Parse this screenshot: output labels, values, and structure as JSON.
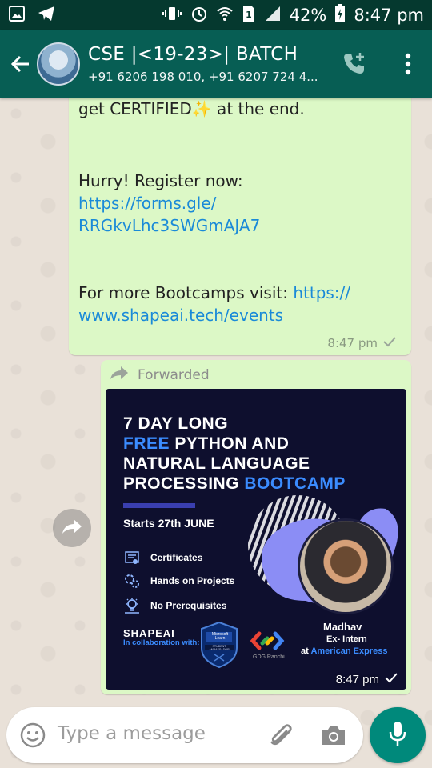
{
  "status_bar": {
    "battery_percent": "42%",
    "time": "8:47 pm",
    "icons": [
      "gallery-icon",
      "telegram-icon",
      "vibrate-icon",
      "alarm-icon",
      "wifi-icon",
      "sim-1-icon",
      "signal-icon",
      "battery-charging-icon"
    ]
  },
  "header": {
    "title": "CSE |<19-23>| BATCH",
    "subtitle": "+91 6206 198 010, +91 6207 724 4...",
    "icons": [
      "back-arrow-icon",
      "add-call-icon",
      "more-vert-icon"
    ]
  },
  "messages": [
    {
      "lines": [
        {
          "text": "get CERTIFIED✨ at the end.",
          "link": false
        },
        {
          "text": "Hurry! Register now:",
          "link": false
        },
        {
          "text": "https://forms.gle/",
          "link": true
        },
        {
          "text": "RRGkvLhc3SWGmAJA7",
          "link": true
        },
        {
          "text": "For more Bootcamps visit: ",
          "link": false
        },
        {
          "text": "https://",
          "link": true
        },
        {
          "text": "www.shapeai.tech/events",
          "link": true
        }
      ],
      "time": "8:47 pm"
    },
    {
      "forwarded_label": "Forwarded",
      "time": "8:47 pm",
      "poster": {
        "headline": [
          {
            "plain": "7 DAY LONG",
            "accent": ""
          },
          {
            "accent": "FREE",
            "plain": " PYTHON AND"
          },
          {
            "plain": "NATURAL LANGUAGE",
            "accent": ""
          },
          {
            "plain": "PROCESSING ",
            "accent": "BOOTCAMP"
          }
        ],
        "starts": "Starts 27th JUNE",
        "features": [
          "Certificates",
          "Hands on Projects",
          "No Prerequisites"
        ],
        "brand": "SHAPEAI",
        "collab": "In collaboration with:",
        "badge_top": "Microsoft Learn",
        "badge_bottom": "STUDENT AMBASSADOR",
        "gdg_label": "GDG Ranchi",
        "speaker_name": "Madhav",
        "speaker_role": "Ex- Intern",
        "speaker_at": "at ",
        "speaker_company": "American Express",
        "accent_color": "#3b8cff",
        "background_color": "#0e0f2e"
      }
    }
  ],
  "composer": {
    "placeholder": "Type a message",
    "icons": [
      "emoji-icon",
      "attach-icon",
      "camera-icon",
      "mic-icon"
    ]
  },
  "colors": {
    "header": "#075e54",
    "status_bar": "#05392f",
    "bubble": "#dcf8c6",
    "link": "#1a8ad8",
    "mic_button": "#00897b"
  }
}
